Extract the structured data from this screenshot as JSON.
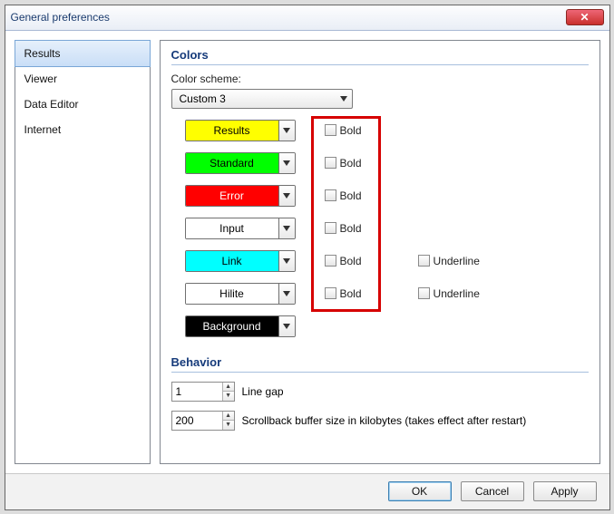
{
  "window": {
    "title": "General preferences"
  },
  "sidebar": {
    "items": [
      {
        "label": "Results",
        "selected": true
      },
      {
        "label": "Viewer",
        "selected": false
      },
      {
        "label": "Data Editor",
        "selected": false
      },
      {
        "label": "Internet",
        "selected": false
      }
    ]
  },
  "colors": {
    "section_title": "Colors",
    "scheme_label": "Color scheme:",
    "scheme_value": "Custom 3",
    "rows": [
      {
        "label": "Results",
        "bg": "#ffff00",
        "fg": "#000000",
        "bold_label": "Bold",
        "bold_checked": false,
        "underline_label": null,
        "underline_checked": null
      },
      {
        "label": "Standard",
        "bg": "#00ff00",
        "fg": "#000000",
        "bold_label": "Bold",
        "bold_checked": false,
        "underline_label": null,
        "underline_checked": null
      },
      {
        "label": "Error",
        "bg": "#ff0000",
        "fg": "#ffffff",
        "bold_label": "Bold",
        "bold_checked": false,
        "underline_label": null,
        "underline_checked": null
      },
      {
        "label": "Input",
        "bg": "#ffffff",
        "fg": "#000000",
        "bold_label": "Bold",
        "bold_checked": false,
        "underline_label": null,
        "underline_checked": null
      },
      {
        "label": "Link",
        "bg": "#00ffff",
        "fg": "#000000",
        "bold_label": "Bold",
        "bold_checked": false,
        "underline_label": "Underline",
        "underline_checked": false
      },
      {
        "label": "Hilite",
        "bg": "#ffffff",
        "fg": "#000000",
        "bold_label": "Bold",
        "bold_checked": false,
        "underline_label": "Underline",
        "underline_checked": false
      },
      {
        "label": "Background",
        "bg": "#000000",
        "fg": "#ffffff",
        "bold_label": null,
        "bold_checked": null,
        "underline_label": null,
        "underline_checked": null
      }
    ]
  },
  "behavior": {
    "section_title": "Behavior",
    "line_gap_value": "1",
    "line_gap_label": "Line gap",
    "scrollback_value": "200",
    "scrollback_label": "Scrollback buffer size in kilobytes (takes effect after restart)"
  },
  "footer": {
    "ok": "OK",
    "cancel": "Cancel",
    "apply": "Apply"
  },
  "annotation": {
    "highlight_box": "bold-checkbox-group"
  }
}
